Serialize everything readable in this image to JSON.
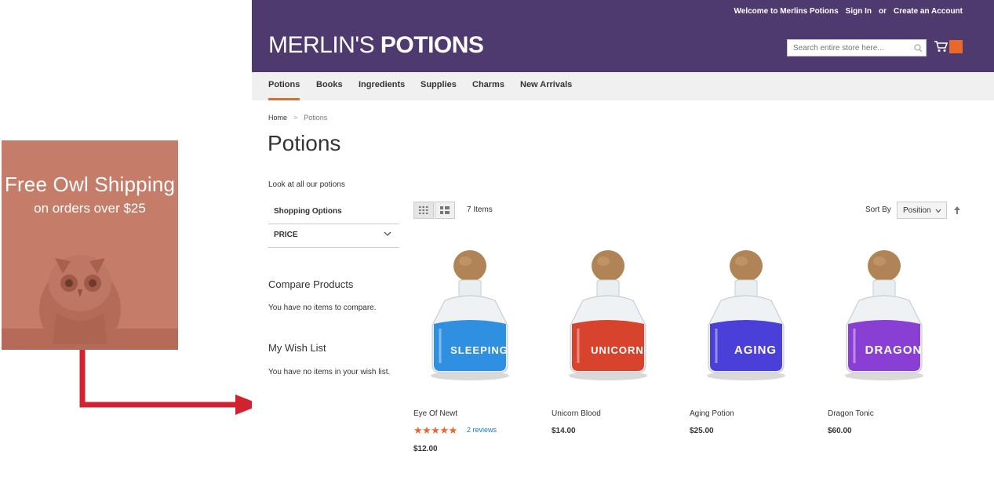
{
  "promo": {
    "title": "Free Owl Shipping",
    "subtitle": "on orders over $25"
  },
  "header": {
    "welcome": "Welcome to Merlins Potions",
    "sign_in": "Sign In",
    "or": "or",
    "create_account": "Create an Account",
    "logo_part1": "MERLIN'S ",
    "logo_part2": "POTIONS",
    "search_placeholder": "Search entire store here...",
    "brand_color": "#4f3a6f",
    "accent_color": "#e8692b"
  },
  "nav": {
    "items": [
      "Potions",
      "Books",
      "Ingredients",
      "Supplies",
      "Charms",
      "New Arrivals"
    ],
    "active": "Potions"
  },
  "breadcrumb": {
    "home": "Home",
    "separator": ">",
    "current": "Potions"
  },
  "page": {
    "title": "Potions",
    "description": "Look at all our potions"
  },
  "sidebar": {
    "shopping_options": "Shopping Options",
    "price": "PRICE",
    "compare_title": "Compare Products",
    "compare_text": "You have no items to compare.",
    "wishlist_title": "My Wish List",
    "wishlist_text": "You have no items in your wish list."
  },
  "toolbar": {
    "items_count": "7 Items",
    "sort_by": "Sort By",
    "sort_value": "Position"
  },
  "products": [
    {
      "name": "Eye Of Newt",
      "price": "$12.00",
      "label": "SLEEPING",
      "stars": "★★★★★",
      "reviews": "2 reviews",
      "liquid": "#2f8fe0"
    },
    {
      "name": "Unicorn Blood",
      "price": "$14.00",
      "label": "UNICORN",
      "liquid": "#d8432e"
    },
    {
      "name": "Aging Potion",
      "price": "$25.00",
      "label": "AGING",
      "liquid": "#4b3fd9"
    },
    {
      "name": "Dragon Tonic",
      "price": "$60.00",
      "label": "DRAGON",
      "liquid": "#8a3fd4"
    }
  ]
}
